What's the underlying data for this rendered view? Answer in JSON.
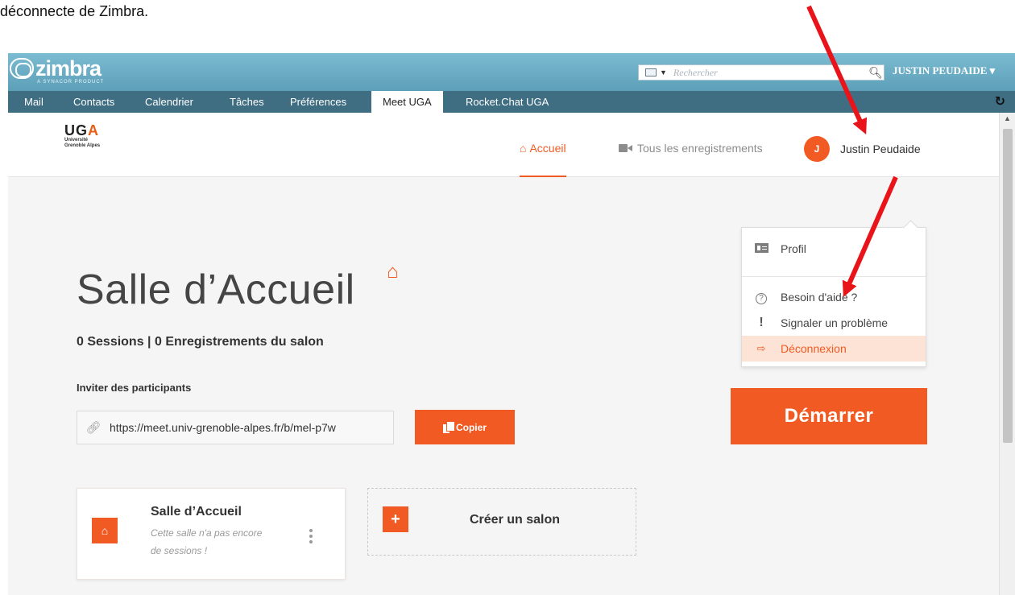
{
  "caption": "déconnecte de Zimbra.",
  "zimbra": {
    "logo_text": "zimbra",
    "logo_sub": "A SYNACOR PRODUCT",
    "search_placeholder": "Rechercher",
    "user_label": "JUSTIN PEUDAIDE ▾",
    "tabs": [
      "Mail",
      "Contacts",
      "Calendrier",
      "Tâches",
      "Préférences",
      "Meet UGA",
      "Rocket.Chat UGA"
    ],
    "active_tab": "Meet UGA"
  },
  "app": {
    "logo_big_a": "UG",
    "logo_big_b": "A",
    "logo_small_1": "Université",
    "logo_small_2": "Grenoble Alpes",
    "nav_home": "Accueil",
    "nav_recordings": "Tous les enregistrements",
    "user_initial": "J",
    "user_name": "Justin Peudaide",
    "menu": {
      "profile": "Profil",
      "help": "Besoin d'aide ?",
      "report": "Signaler un problème",
      "logout": "Déconnexion"
    },
    "room_title": "Salle d’Accueil",
    "sessions_text": "0 Sessions | 0 Enregistrements du salon",
    "invite_label": "Inviter des participants",
    "invite_url": "https://meet.univ-grenoble-alpes.fr/b/mel-p7w",
    "copy_label": "Copier",
    "start_label": "Démarrer",
    "room_card": {
      "name": "Salle d’Accueil",
      "desc": "Cette salle n'a pas encore de sessions !"
    },
    "create_room": "Créer un salon"
  },
  "colors": {
    "accent": "#f15a22",
    "zimbra_header": "#6aaac2",
    "zimbra_tabs": "#3f6e82",
    "annotation_arrow": "#e8141a"
  }
}
